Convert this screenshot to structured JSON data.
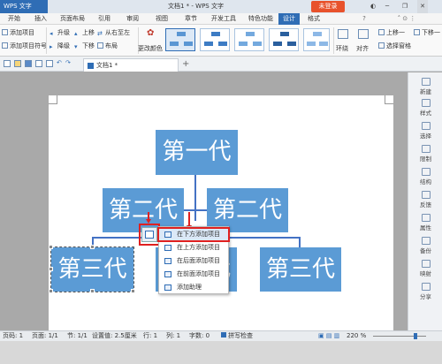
{
  "titlebar": {
    "app": "WPS 文字",
    "title": "文档1 * - WPS 文字",
    "login": "未登录"
  },
  "menu": [
    "开始",
    "插入",
    "页面布局",
    "引用",
    "审阅",
    "视图",
    "章节",
    "开发工具",
    "特色功能",
    "设计",
    "格式"
  ],
  "ribbon": {
    "add_item": "添加项目",
    "add_bullet": "添加项目符号",
    "promote": "升级",
    "demote": "降级",
    "move_up": "上移",
    "move_down": "下移",
    "rtl": "从右至左",
    "layout": "布局",
    "change_color": "更改颜色",
    "wrap": "环绕",
    "align": "对齐",
    "up_one": "上移一",
    "down_one": "下移一",
    "select_pane": "选择窗格"
  },
  "doc_tab": "文档1 *",
  "chart": {
    "gen1": "第一代",
    "gen2": "第二代",
    "gen3": "第三代"
  },
  "context_menu": [
    "在下方添加项目",
    "在上方添加项目",
    "在后面添加项目",
    "在前面添加项目",
    "添加助理"
  ],
  "right_sidebar": [
    "新建",
    "样式",
    "选择",
    "限制",
    "结构",
    "反馈",
    "属性",
    "备份",
    "映射",
    "分享"
  ],
  "status": {
    "page": "页码: 1",
    "pages": "页面: 1/1",
    "section": "节: 1/1",
    "setting": "设置值: 2.5厘米",
    "row": "行: 1",
    "col": "列: 1",
    "chars": "字数: 0",
    "spell": "拼写检查",
    "zoom": "220 %"
  },
  "colors": {
    "accent": "#2f6db5",
    "node": "#5b9bd5",
    "highlight": "#e02020"
  }
}
